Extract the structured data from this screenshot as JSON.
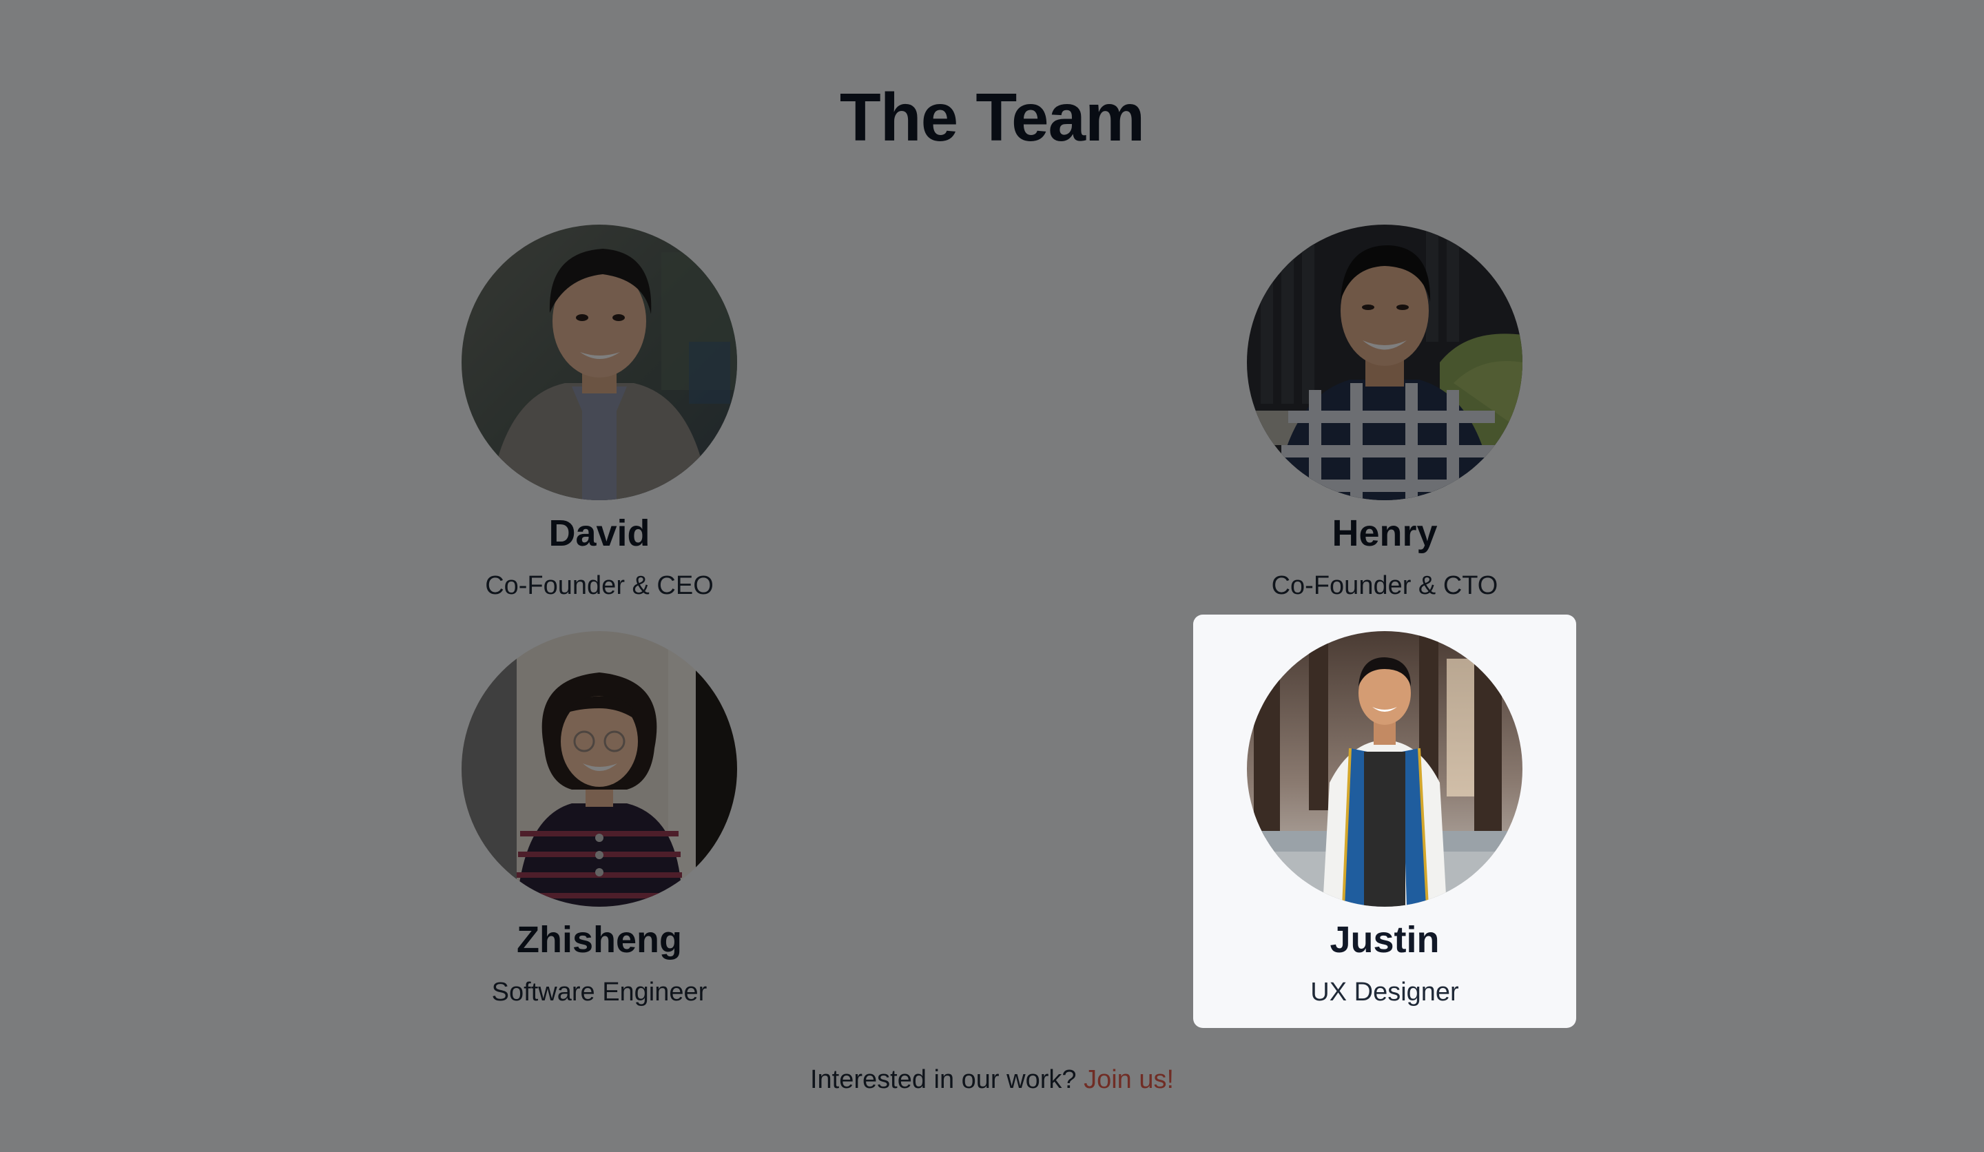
{
  "page": {
    "title": "The Team"
  },
  "team": [
    {
      "name": "David",
      "role": "Co-Founder & CEO",
      "photo": "portrait-david"
    },
    {
      "name": "Henry",
      "role": "Co-Founder & CTO",
      "photo": "portrait-henry"
    },
    {
      "name": "Zhisheng",
      "role": "Software Engineer",
      "photo": "portrait-zhisheng"
    },
    {
      "name": "Justin",
      "role": "UX Designer",
      "photo": "portrait-justin",
      "highlighted": true
    }
  ],
  "footer": {
    "text": "Interested in our work?",
    "link_label": "Join us!"
  },
  "colors": {
    "background": "#f7f8fa",
    "heading": "#111827",
    "link": "#e05a4a",
    "overlay": "rgba(0,0,0,0.5)"
  }
}
